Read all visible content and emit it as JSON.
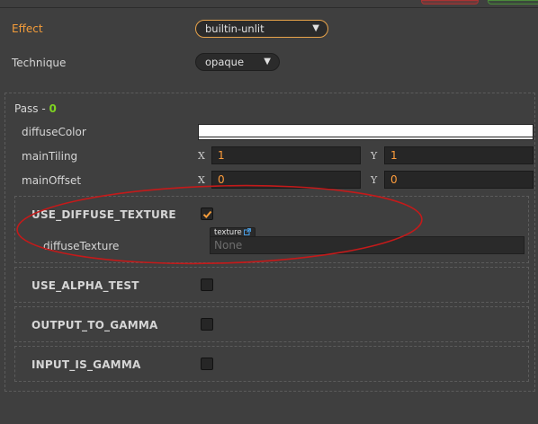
{
  "effect": {
    "label": "Effect",
    "value": "builtin-unlit"
  },
  "technique": {
    "label": "Technique",
    "value": "opaque"
  },
  "pass": {
    "label": "Pass - ",
    "index": "0"
  },
  "properties": {
    "diffuse_color": {
      "label": "diffuseColor",
      "color": "#ffffff"
    },
    "main_tiling": {
      "label": "mainTiling",
      "x_axis": "X",
      "x": "1",
      "y_axis": "Y",
      "y": "1"
    },
    "main_offset": {
      "label": "mainOffset",
      "x_axis": "X",
      "x": "0",
      "y_axis": "Y",
      "y": "0"
    }
  },
  "defines": {
    "use_diffuse_texture": {
      "label": "USE_DIFFUSE_TEXTURE",
      "checked": true,
      "texture": {
        "label": "diffuseTexture",
        "tag": "texture",
        "value": "None"
      }
    },
    "use_alpha_test": {
      "label": "USE_ALPHA_TEST",
      "checked": false
    },
    "output_to_gamma": {
      "label": "OUTPUT_TO_GAMMA",
      "checked": false
    },
    "input_is_gamma": {
      "label": "INPUT_IS_GAMMA",
      "checked": false
    }
  },
  "colors": {
    "accent_orange": "#e8a34a",
    "pass_index_green": "#7ed321",
    "annotation_red": "#c41a1a"
  },
  "icons": [
    "chevron-down-icon",
    "checkmark-icon",
    "external-link-icon"
  ]
}
